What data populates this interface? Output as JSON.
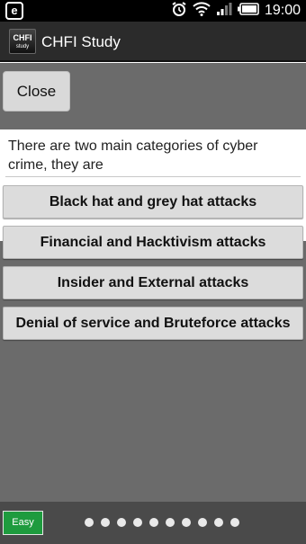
{
  "status_bar": {
    "app_badge": "e",
    "time": "19:00"
  },
  "app_bar": {
    "logo_line1": "CHFI",
    "logo_line2": "study",
    "title": "CHFI Study"
  },
  "close_label": "Close",
  "question": "There are two main categories of cyber crime, they are",
  "answers": [
    "Black hat and grey hat attacks",
    "Financial and Hacktivism attacks",
    "Insider and External attacks",
    "Denial of service and Bruteforce attacks"
  ],
  "difficulty_label": "Easy",
  "page_dots_count": 10
}
